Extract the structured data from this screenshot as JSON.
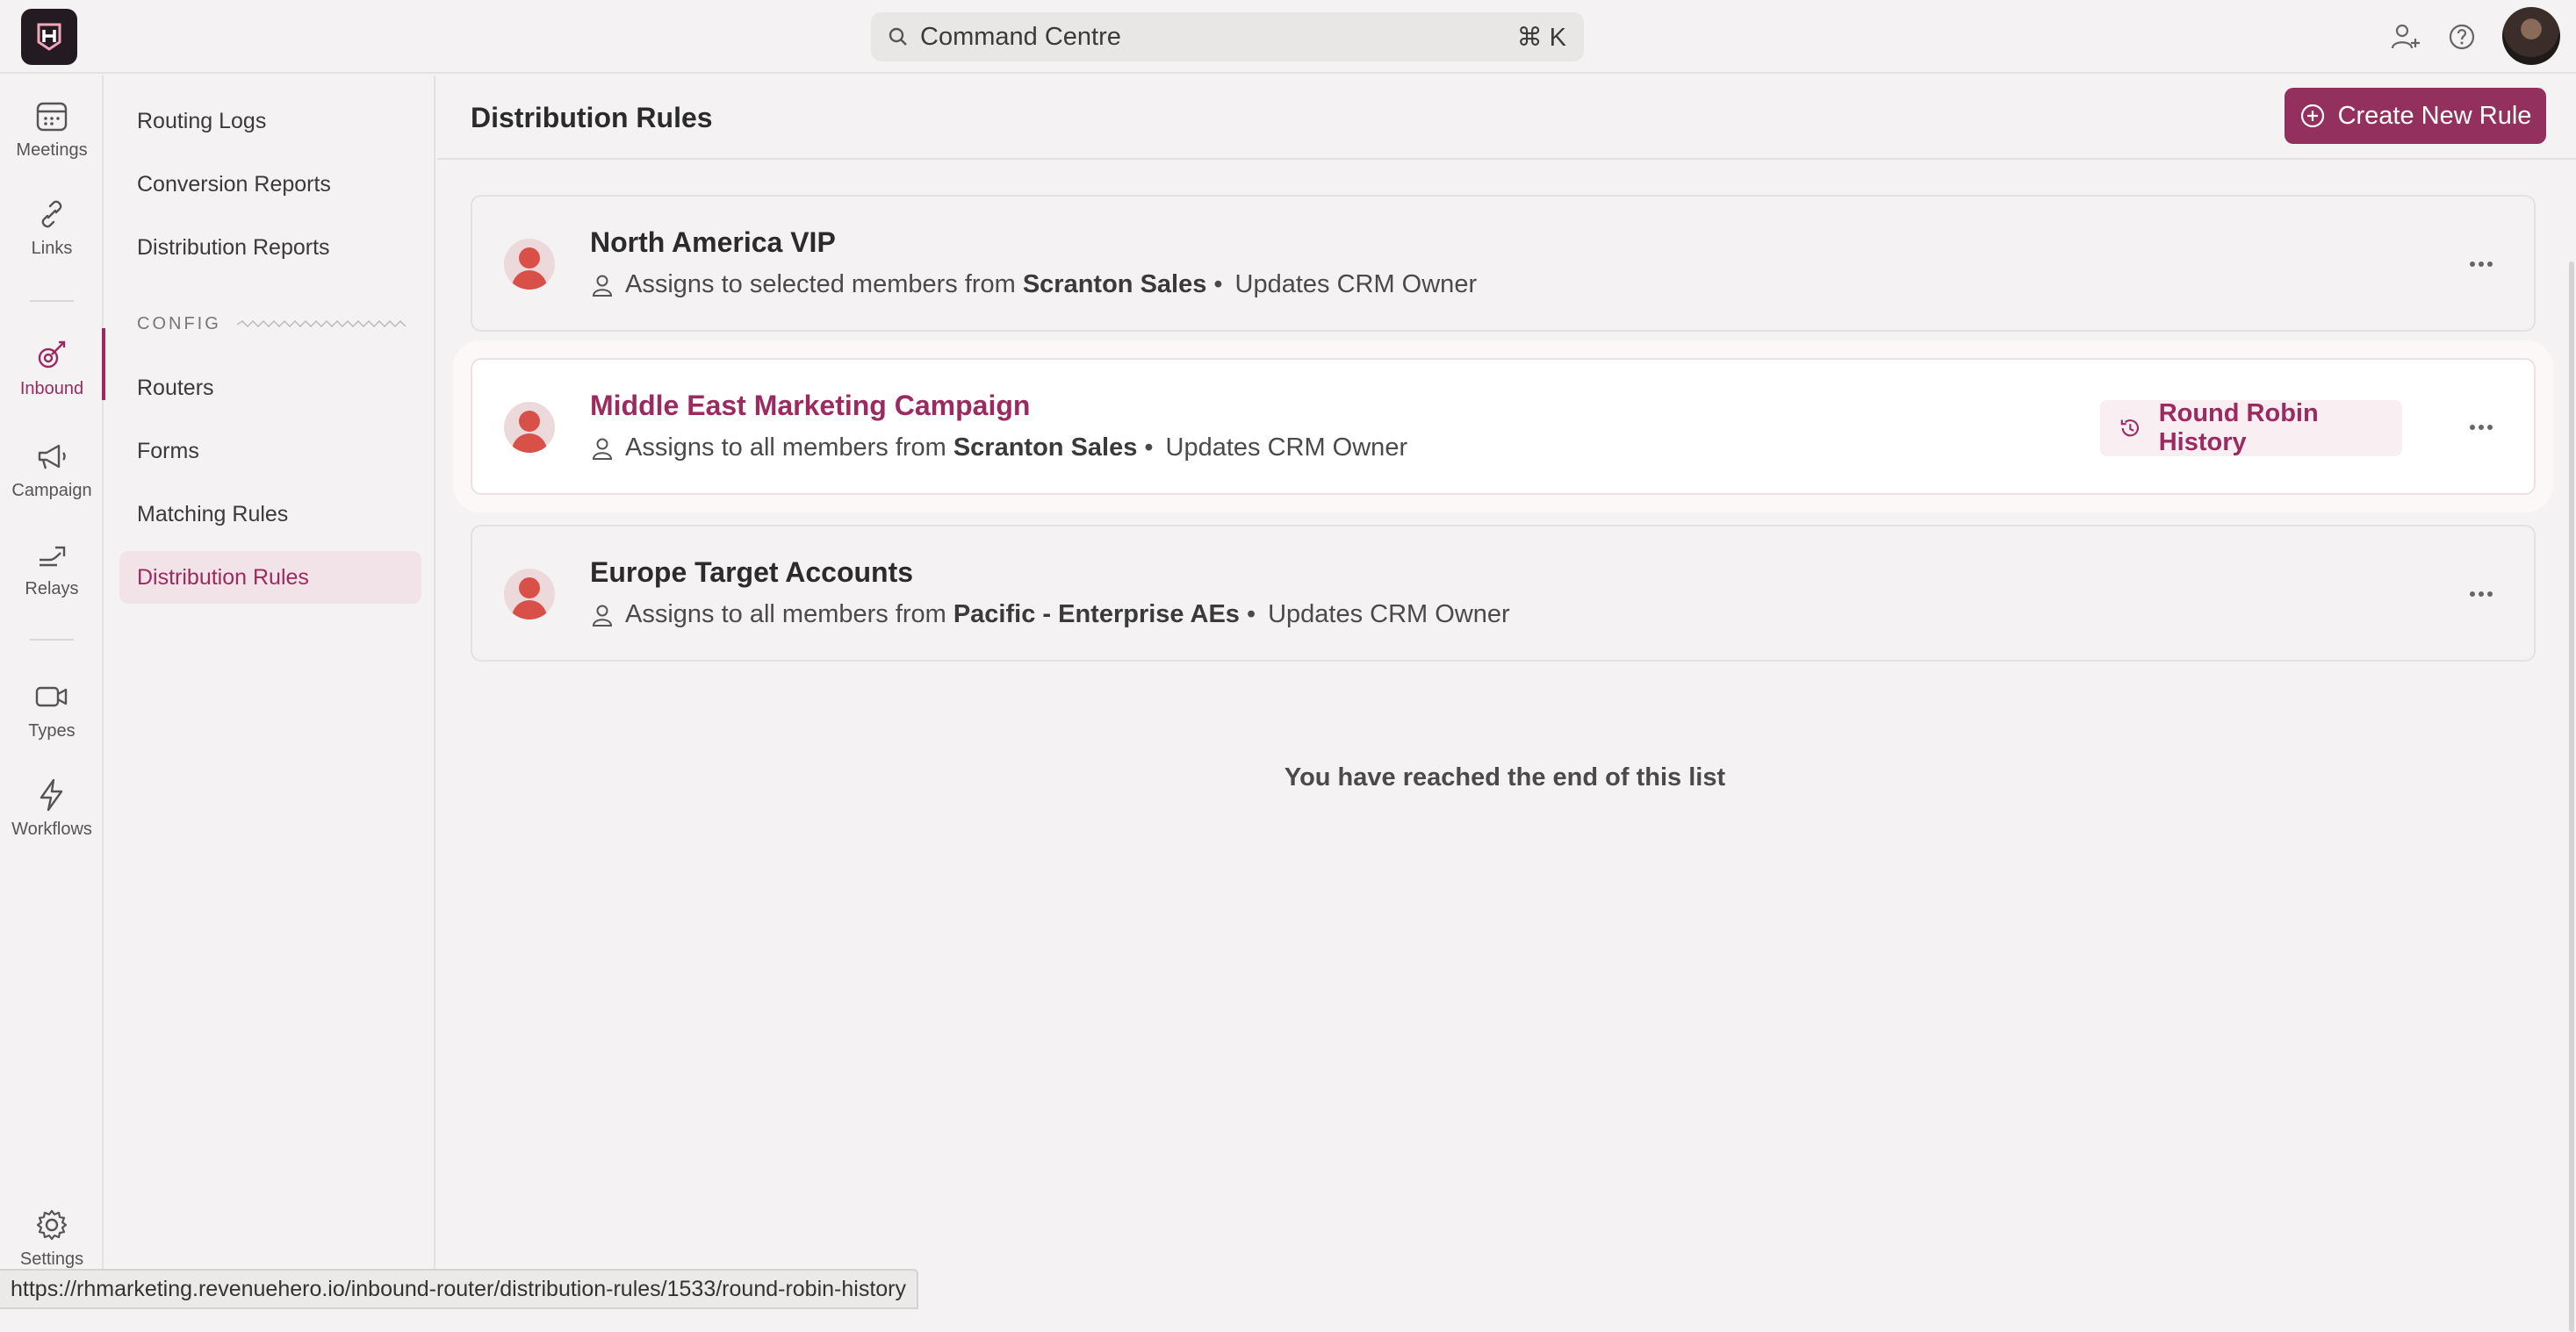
{
  "colors": {
    "accent": "#94305d",
    "accent_text": "#9b2a61",
    "avatar_red": "#d95048"
  },
  "search": {
    "label": "Command Centre",
    "shortcut": "⌘ K",
    "icon": "search-icon"
  },
  "topbar": {
    "icons": [
      "add-user-icon",
      "help-icon",
      "user-avatar"
    ]
  },
  "rail": {
    "items": [
      {
        "label": "Meetings",
        "icon": "calendar-icon"
      },
      {
        "label": "Links",
        "icon": "link-icon"
      },
      {
        "label": "Inbound",
        "icon": "inbound-icon",
        "active": true
      },
      {
        "label": "Campaign",
        "icon": "megaphone-icon"
      },
      {
        "label": "Relays",
        "icon": "relay-icon"
      },
      {
        "label": "Types",
        "icon": "video-icon"
      },
      {
        "label": "Workflows",
        "icon": "lightning-icon"
      },
      {
        "label": "Settings",
        "icon": "gear-icon"
      }
    ]
  },
  "subnav": {
    "items": [
      "Routing Logs",
      "Conversion Reports",
      "Distribution Reports"
    ],
    "config_label": "CONFIG",
    "config_items": [
      "Routers",
      "Forms",
      "Matching Rules",
      "Distribution Rules"
    ],
    "active": "Distribution Rules"
  },
  "page": {
    "title": "Distribution Rules",
    "create_button": "Create New Rule",
    "end_text": "You have reached the end of this list"
  },
  "rules": [
    {
      "title": "North America VIP",
      "assign_prefix": "Assigns to selected members from",
      "team": "Scranton Sales",
      "bullet": "•",
      "action": "Updates CRM Owner"
    },
    {
      "title": "Middle East Marketing Campaign",
      "assign_prefix": "Assigns to all members from",
      "team": "Scranton Sales",
      "bullet": "•",
      "action": "Updates CRM Owner",
      "history_button": "Round Robin History",
      "highlighted": true
    },
    {
      "title": "Europe Target Accounts",
      "assign_prefix": "Assigns to all members from",
      "team": "Pacific - Enterprise AEs",
      "bullet": "•",
      "action": "Updates CRM Owner"
    }
  ],
  "status_url": "https://rhmarketing.revenuehero.io/inbound-router/distribution-rules/1533/round-robin-history"
}
